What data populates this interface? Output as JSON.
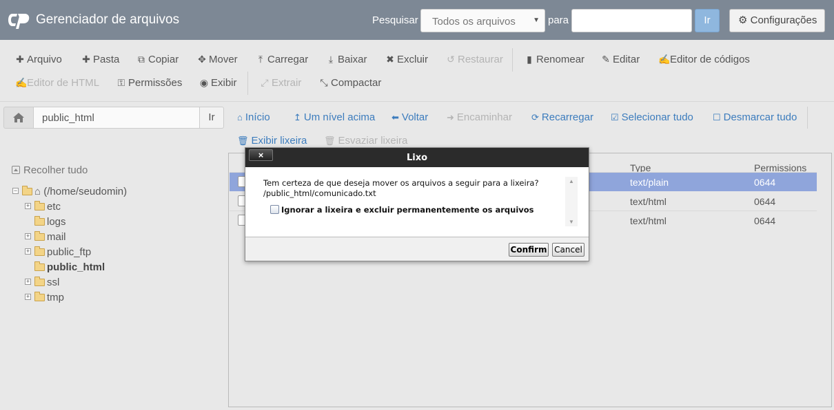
{
  "header": {
    "app_title": "Gerenciador de arquivos",
    "search_label": "Pesquisar",
    "search_scope": "Todos os arquivos",
    "para_label": "para",
    "search_value": "",
    "go_label": "Ir",
    "settings_label": "Configurações"
  },
  "toolbar": {
    "row1": [
      {
        "label": "Arquivo",
        "icon": "plus-icon"
      },
      {
        "label": "Pasta",
        "icon": "plus-icon"
      },
      {
        "label": "Copiar",
        "icon": "copy-icon"
      },
      {
        "label": "Mover",
        "icon": "move-icon"
      },
      {
        "label": "Carregar",
        "icon": "upload-icon"
      },
      {
        "label": "Baixar",
        "icon": "download-icon"
      },
      {
        "label": "Excluir",
        "icon": "close-icon"
      },
      {
        "label": "Restaurar",
        "icon": "undo-icon"
      },
      {
        "label": "Renomear",
        "icon": "file-icon"
      },
      {
        "label": "Editar",
        "icon": "pencil-icon"
      },
      {
        "label": "Editor de códigos",
        "icon": "edit-icon"
      }
    ],
    "row2": [
      {
        "label": "Editor de HTML",
        "icon": "edit-icon"
      },
      {
        "label": "Permissões",
        "icon": "key-icon"
      },
      {
        "label": "Exibir",
        "icon": "eye-icon"
      },
      {
        "label": "Extrair",
        "icon": "expand-icon"
      },
      {
        "label": "Compactar",
        "icon": "compress-icon"
      }
    ]
  },
  "pathbar": {
    "path": "public_html",
    "go_label": "Ir"
  },
  "nav": {
    "home": "Início",
    "up": "Um nível acima",
    "back": "Voltar",
    "forward": "Encaminhar",
    "reload": "Recarregar",
    "select_all": "Selecionar tudo",
    "unselect_all": "Desmarcar tudo",
    "view_trash": "Exibir lixeira",
    "empty_trash": "Esvaziar lixeira"
  },
  "tree": {
    "collapse_all": "Recolher tudo",
    "root": "(/home/seudomin)",
    "folders": [
      "etc",
      "logs",
      "mail",
      "public_ftp",
      "public_html",
      "ssl",
      "tmp"
    ]
  },
  "filelist": {
    "columns": {
      "type": "Type",
      "permissions": "Permissions"
    },
    "rows": [
      {
        "type": "text/plain",
        "permissions": "0644"
      },
      {
        "type": "text/html",
        "permissions": "0644"
      },
      {
        "type": "text/html",
        "permissions": "0644"
      }
    ]
  },
  "modal": {
    "title": "Lixo",
    "close": "×",
    "message": "Tem certeza de que deseja mover os arquivos a seguir para a lixeira?",
    "file_path": "/public_html/comunicado.txt",
    "checkbox_label": "Ignorar a lixeira e excluir permanentemente os arquivos",
    "confirm_label": "Confirm",
    "cancel_label": "Cancel"
  },
  "colors": {
    "header_bg": "#7d8895",
    "link": "#3c7cbd",
    "selected_row": "#8fa5db"
  }
}
